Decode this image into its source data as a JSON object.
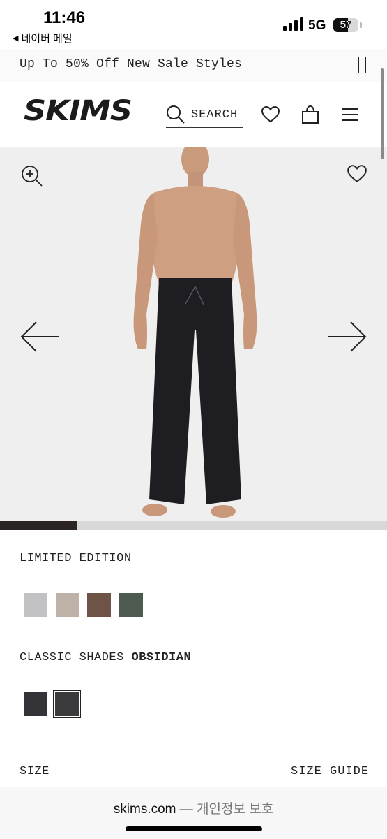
{
  "status_bar": {
    "time": "11:46",
    "back_app": "네이버 메일",
    "network": "5G",
    "battery": "57"
  },
  "promo": {
    "text": "Up To 50% Off New Sale Styles"
  },
  "header": {
    "logo": "SKIMS",
    "search_label": "SEARCH"
  },
  "gallery": {
    "progress_fraction": 0.2
  },
  "options": {
    "limited_label": "LIMITED EDITION",
    "limited_swatches": [
      "#c2c2c4",
      "#bdb1a8",
      "#6d5446",
      "#4c5a50"
    ],
    "classic_label": "CLASSIC SHADES",
    "classic_selected": "OBSIDIAN",
    "classic_swatches": [
      "#333338",
      "#3b3a3d"
    ],
    "size_label": "SIZE",
    "size_guide": "SIZE GUIDE"
  },
  "browser": {
    "domain": "skims.com",
    "separator": " — ",
    "privacy": "개인정보 보호"
  }
}
